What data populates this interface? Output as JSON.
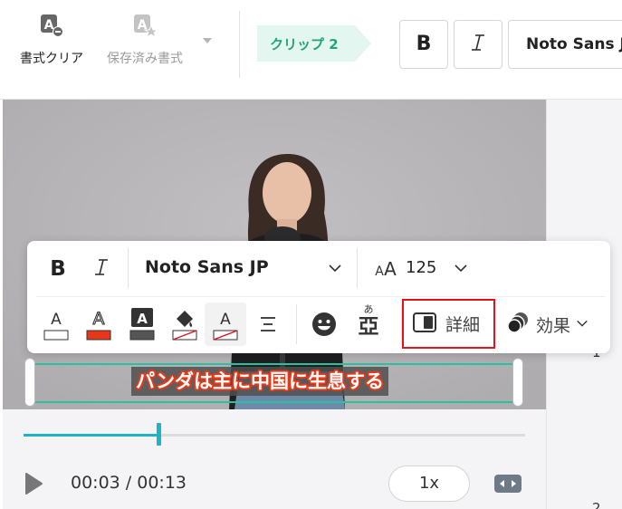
{
  "toolbar": {
    "clear_format_label": "書式クリア",
    "saved_format_label": "保存済み書式",
    "clip_tag_label": "クリップ 2",
    "font_name": "Noto Sans JP"
  },
  "side_panel": {
    "row_numbers": [
      "1",
      "2"
    ]
  },
  "video": {
    "subtitle_text": "パンダは主に中国に生息する"
  },
  "float_toolbar": {
    "font_name": "Noto Sans JP",
    "font_size": "125",
    "ruby_glyph": "あ",
    "ruby_base": "亞",
    "detail_label": "詳細",
    "effect_label": "効果"
  },
  "player": {
    "time_display": "00:03 / 00:13",
    "progress_fraction": 0.27,
    "speed_label": "1x"
  },
  "colors": {
    "accent_teal": "#27c2a0",
    "progress": "#1eb3c6",
    "subtitle_outline": "#e23a1a",
    "highlight_red": "#e0141e",
    "clip_tag_bg": "#e3f6ef"
  },
  "icons": {
    "clear_format": "clear-format-icon",
    "saved_format": "saved-format-icon",
    "bold": "bold-icon",
    "italic": "italic-icon",
    "font_size": "font-size-icon",
    "align": "align-center-icon",
    "emoji": "emoji-icon",
    "detail": "detail-panel-icon",
    "effect": "effect-icon",
    "play": "play-icon",
    "fit": "fit-screen-icon"
  }
}
